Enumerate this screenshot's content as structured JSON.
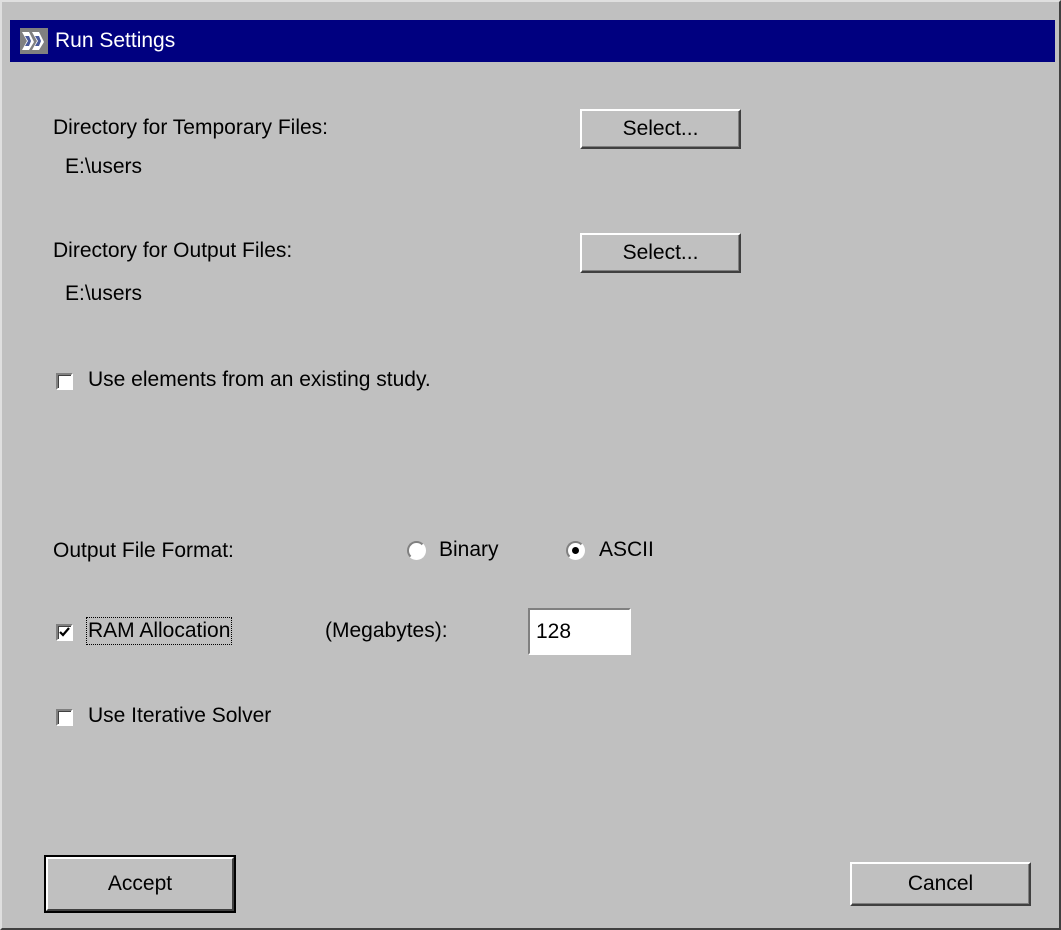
{
  "window": {
    "title": "Run Settings",
    "icon": "app-logo-icon"
  },
  "temp_dir": {
    "label": "Directory for Temporary Files:",
    "value": "E:\\users",
    "button": "Select..."
  },
  "output_dir": {
    "label": "Directory for Output Files:",
    "value": "E:\\users",
    "button": "Select..."
  },
  "use_existing": {
    "label": "Use elements from an existing study.",
    "checked": false
  },
  "output_format": {
    "label": "Output File Format:",
    "options": [
      {
        "label": "Binary",
        "selected": false
      },
      {
        "label": "ASCII",
        "selected": true
      }
    ]
  },
  "ram": {
    "label": "RAM Allocation",
    "checked": true,
    "unit_label": "(Megabytes):",
    "value": "128"
  },
  "iterative": {
    "label": "Use Iterative Solver",
    "checked": false
  },
  "actions": {
    "accept": "Accept",
    "cancel": "Cancel"
  },
  "colors": {
    "title_bar": "#000080",
    "background": "#c0c0c0"
  }
}
